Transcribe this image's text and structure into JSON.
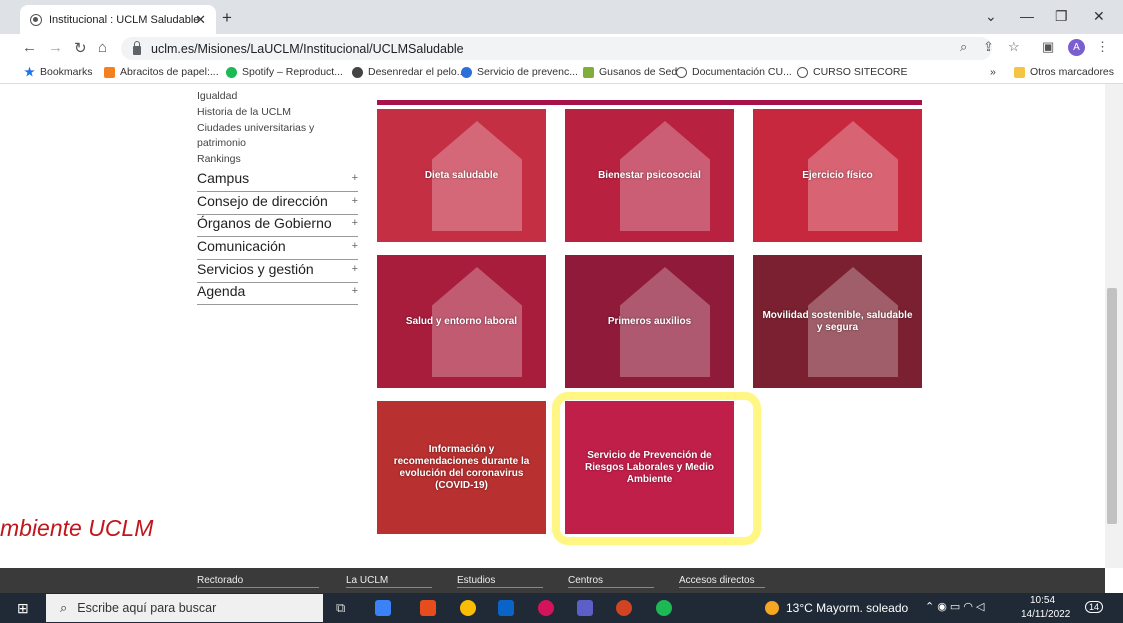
{
  "browser": {
    "tab_title": "Institucional : UCLM Saludable",
    "url": "uclm.es/Misiones/LaUCLM/Institucional/UCLMSaludable",
    "bookmarks": [
      {
        "label": "Bookmarks",
        "color": "#1a73e8"
      },
      {
        "label": "Abracitos de papel:...",
        "color": "#f4801f"
      },
      {
        "label": "Spotify – Reproduct...",
        "color": "#1db954"
      },
      {
        "label": "Desenredar el pelo...",
        "color": "#444444"
      },
      {
        "label": "Servicio de prevenc...",
        "color": "#2a6fdb"
      },
      {
        "label": "Gusanos de Seda",
        "color": "#7fae3a"
      },
      {
        "label": "Documentación CU...",
        "color": "#555555"
      },
      {
        "label": "CURSO SITECORE",
        "color": "#555555"
      }
    ],
    "more_bookmarks": "»",
    "other_bookmarks": "Otros marcadores",
    "avatar_letter": "A"
  },
  "sidebar": {
    "subitems": [
      "Igualdad",
      "Historia de la UCLM",
      "Ciudades universitarias y",
      "patrimonio",
      "Rankings"
    ],
    "menu": [
      {
        "label": "Campus",
        "toggle": "+"
      },
      {
        "label": "Consejo de dirección",
        "toggle": "+"
      },
      {
        "label": "Órganos de Gobierno",
        "toggle": "+"
      },
      {
        "label": "Comunicación",
        "toggle": "+"
      },
      {
        "label": "Servicios y gestión",
        "toggle": "+"
      },
      {
        "label": "Agenda",
        "toggle": "+"
      }
    ]
  },
  "tiles": [
    {
      "label": "Dieta saludable",
      "color": "#c42f44"
    },
    {
      "label": "Bienestar psicosocial",
      "color": "#b8213f"
    },
    {
      "label": "Ejercicio físico",
      "color": "#c8283e"
    },
    {
      "label": "Salud y entorno laboral",
      "color": "#a81c3c"
    },
    {
      "label": "Primeros auxilios",
      "color": "#8f1a3a"
    },
    {
      "label": "Movilidad sostenible, saludable y segura",
      "color": "#7a2030"
    },
    {
      "label": "Información y recomendaciones durante la evolución del coronavirus (COVID-19)",
      "color": "#b83030"
    },
    {
      "label": "Servicio de Prevención de Riesgos Laborales y Medio Ambiente",
      "color": "#c01f4a"
    }
  ],
  "side_text": "mbiente UCLM",
  "footer": {
    "columns": [
      "Rectorado",
      "La UCLM",
      "Estudios",
      "Centros",
      "Accesos directos"
    ]
  },
  "taskbar": {
    "search_placeholder": "Escribe aquí para buscar",
    "weather": "13°C  Mayorm. soleado",
    "time": "10:54",
    "date": "14/11/2022",
    "notifications": "14"
  }
}
